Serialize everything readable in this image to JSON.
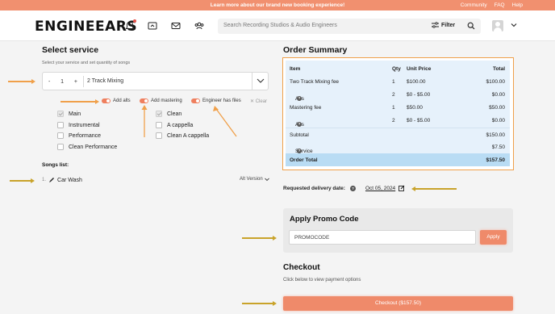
{
  "announcement": {
    "message": "Learn more about our brand new booking experience!",
    "links": [
      "Community",
      "FAQ",
      "Help"
    ]
  },
  "header": {
    "logo": "ENGINEEARS",
    "search_placeholder": "Search Recording Studios & Audio Engineers",
    "filter_label": "Filter",
    "icons": [
      "bell-icon",
      "folder-icon",
      "mail-icon",
      "people-icon",
      "search-icon",
      "avatar",
      "chevron-down-icon"
    ]
  },
  "select_service": {
    "title": "Select service",
    "subtitle": "Select your service and set quantity of songs",
    "quantity": "1",
    "minus": "-",
    "plus": "+",
    "service_name": "2 Track Mixing",
    "toggles": [
      "Add alts",
      "Add mastering",
      "Engineer has files"
    ],
    "clear_label": "Clear",
    "options_left": [
      {
        "label": "Main",
        "checked": true
      },
      {
        "label": "Instrumental",
        "checked": false
      },
      {
        "label": "Performance",
        "checked": false
      },
      {
        "label": "Clean Performance",
        "checked": false
      }
    ],
    "options_right": [
      {
        "label": "Clean",
        "checked": true
      },
      {
        "label": "A cappella",
        "checked": false
      },
      {
        "label": "Clean A cappella",
        "checked": false
      }
    ]
  },
  "songs": {
    "title": "Songs list:",
    "items": [
      {
        "number": "1.",
        "name": "Car Wash"
      }
    ],
    "alt_version_label": "Alt Version"
  },
  "order_summary": {
    "title": "Order Summary",
    "headers": {
      "item": "Item",
      "qty": "Qty",
      "unit": "Unit Price",
      "total": "Total"
    },
    "rows": [
      {
        "item": "Two Track Mixing fee",
        "qty": "1",
        "unit": "$100.00",
        "total": "$100.00"
      },
      {
        "item": "Alts",
        "qty": "2",
        "unit": "$0 - $5.00",
        "total": "$0.00"
      },
      {
        "item": "Mastering fee",
        "qty": "1",
        "unit": "$50.00",
        "total": "$50.00"
      },
      {
        "item": "Alts",
        "qty": "2",
        "unit": "$0 - $5.00",
        "total": "$0.00"
      }
    ],
    "subtotal_label": "Subtotal",
    "subtotal": "$150.00",
    "service_fee_label": "Service Fee",
    "service_fee": "$7.50",
    "order_total_label": "Order Total",
    "order_total": "$157.50"
  },
  "delivery": {
    "label": "Requested delivery date:",
    "date": "Oct 05, 2024"
  },
  "promo": {
    "title": "Apply Promo Code",
    "value": "PROMOCODE",
    "apply_label": "Apply"
  },
  "checkout": {
    "title": "Checkout",
    "subtitle": "Click below to view payment options",
    "button_label": "Checkout ($157.50)"
  },
  "colors": {
    "accent": "#ef8a6a",
    "banner": "#f1906f",
    "highlight_border": "#f0a04a",
    "summary_bg": "#e6f1fb",
    "total_row": "#b9dcf4",
    "annotation_arrow": "#c9a32a"
  }
}
